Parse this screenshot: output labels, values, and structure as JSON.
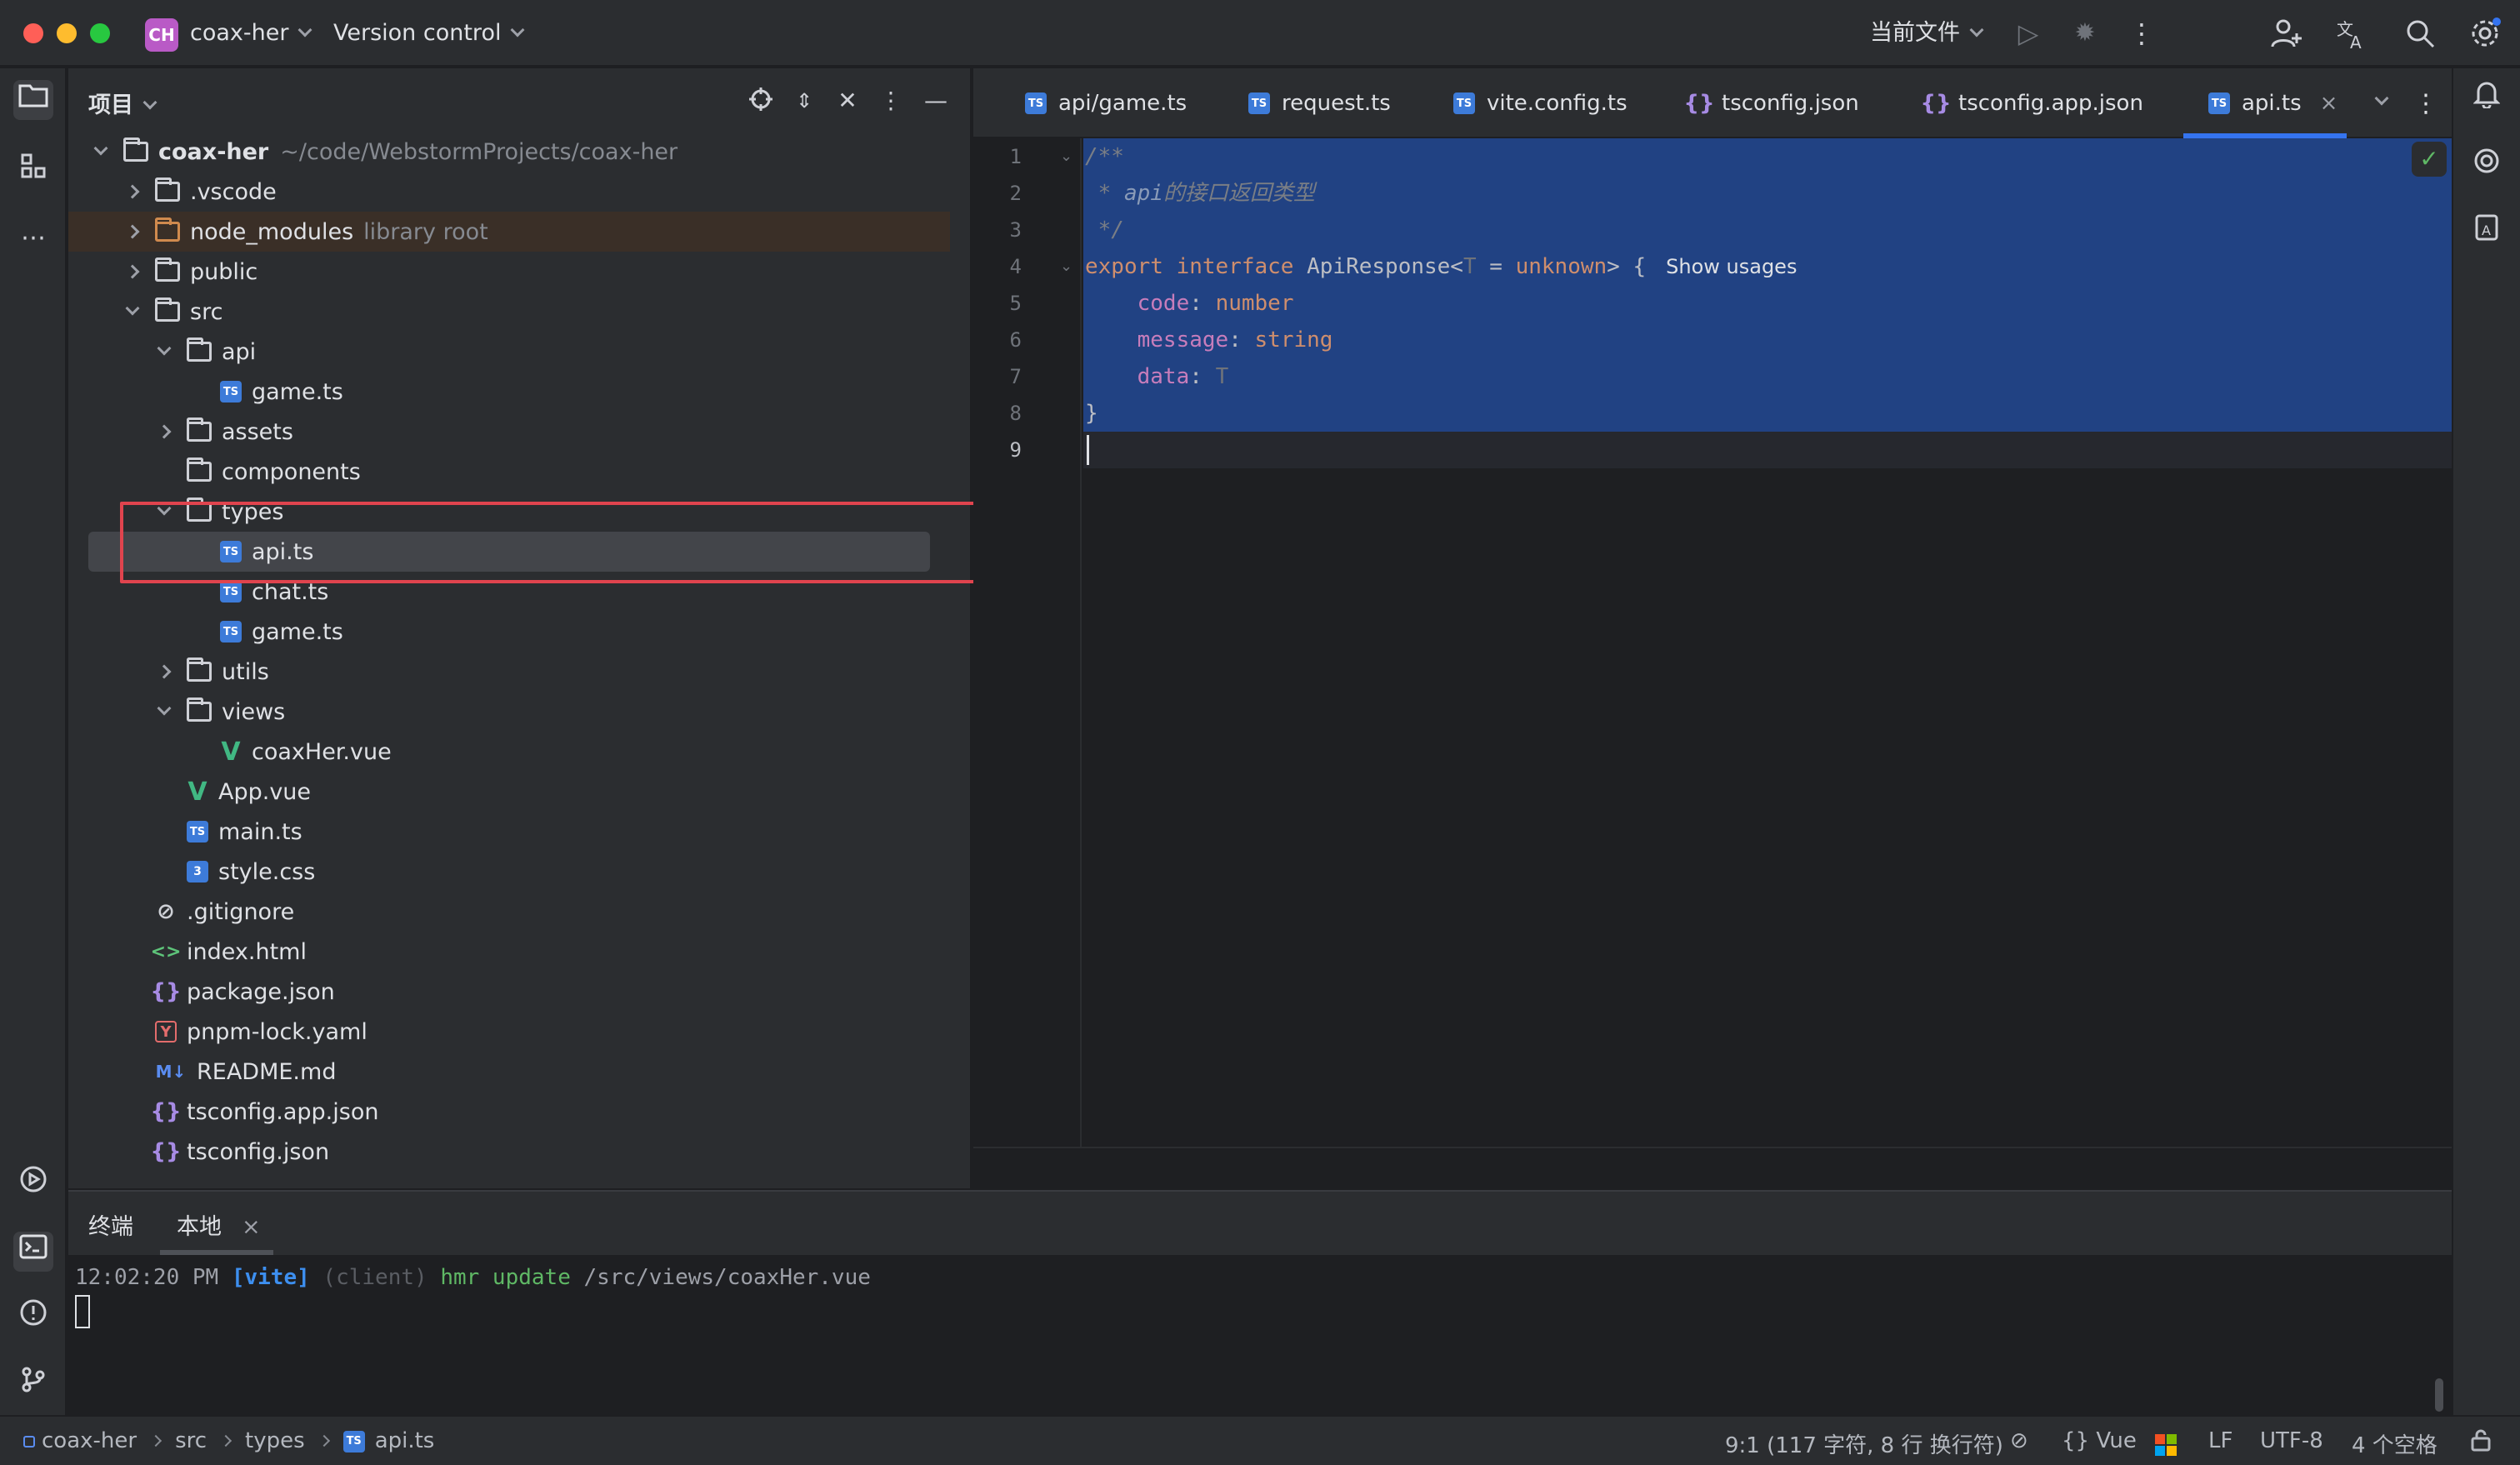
{
  "titlebar": {
    "project_badge": "CH",
    "project_name": "coax-her",
    "vcs": "Version control",
    "run_config": "当前文件"
  },
  "project_panel": {
    "title": "项目",
    "tree": [
      {
        "name": "coax-her",
        "extra": "~/code/WebstormProjects/coax-her"
      },
      {
        "name": ".vscode"
      },
      {
        "name": "node_modules",
        "extra": "library root"
      },
      {
        "name": "public"
      },
      {
        "name": "src"
      },
      {
        "name": "api"
      },
      {
        "name": "game.ts"
      },
      {
        "name": "assets"
      },
      {
        "name": "components"
      },
      {
        "name": "types"
      },
      {
        "name": "api.ts"
      },
      {
        "name": "chat.ts"
      },
      {
        "name": "game.ts"
      },
      {
        "name": "utils"
      },
      {
        "name": "views"
      },
      {
        "name": "coaxHer.vue"
      },
      {
        "name": "App.vue"
      },
      {
        "name": "main.ts"
      },
      {
        "name": "style.css"
      },
      {
        "name": ".gitignore"
      },
      {
        "name": "index.html"
      },
      {
        "name": "package.json"
      },
      {
        "name": "pnpm-lock.yaml"
      },
      {
        "name": "README.md"
      },
      {
        "name": "tsconfig.app.json"
      },
      {
        "name": "tsconfig.json"
      }
    ]
  },
  "tabs": [
    {
      "label": "api/game.ts",
      "icon": "ts"
    },
    {
      "label": "request.ts",
      "icon": "ts"
    },
    {
      "label": "vite.config.ts",
      "icon": "ts"
    },
    {
      "label": "tsconfig.json",
      "icon": "json"
    },
    {
      "label": "tsconfig.app.json",
      "icon": "json"
    },
    {
      "label": "api.ts",
      "icon": "ts",
      "active": true
    }
  ],
  "editor": {
    "line_numbers": [
      "1",
      "2",
      "3",
      "4",
      "5",
      "6",
      "7",
      "8",
      "9"
    ],
    "lines": {
      "l1": "/**",
      "l2_star": " * ",
      "l2_tag": "api",
      "l2_text": "的接口返回类型",
      "l3": " */",
      "l4_export": "export",
      "l4_interface": "interface",
      "l4_name": "ApiResponse<",
      "l4_tp": "T",
      "l4_eq": " = ",
      "l4_unknown": "unknown",
      "l4_end": "> {",
      "l4_inlay": "Show usages",
      "l5_prop": "code",
      "l5_type": "number",
      "l6_prop": "message",
      "l6_type": "string",
      "l7_prop": "data",
      "l7_type": "T",
      "l8": "}",
      "colon": ": "
    }
  },
  "terminal": {
    "tab_title": "终端",
    "tab_local": "本地",
    "time": "12:02:20 PM",
    "tag": "[vite]",
    "client": "(client)",
    "hmr": "hmr update",
    "path": "/src/views/coaxHer.vue"
  },
  "statusbar": {
    "breadcrumb": [
      "coax-her",
      "src",
      "types",
      "api.ts"
    ],
    "position": "9:1 (117 字符, 8 行 换行符)",
    "language": "Vue",
    "line_ending": "LF",
    "encoding": "UTF-8",
    "indent": "4 个空格"
  },
  "colors": {
    "accent": "#3574f0",
    "selection": "#214283",
    "highlight_box": "#e0444e"
  }
}
